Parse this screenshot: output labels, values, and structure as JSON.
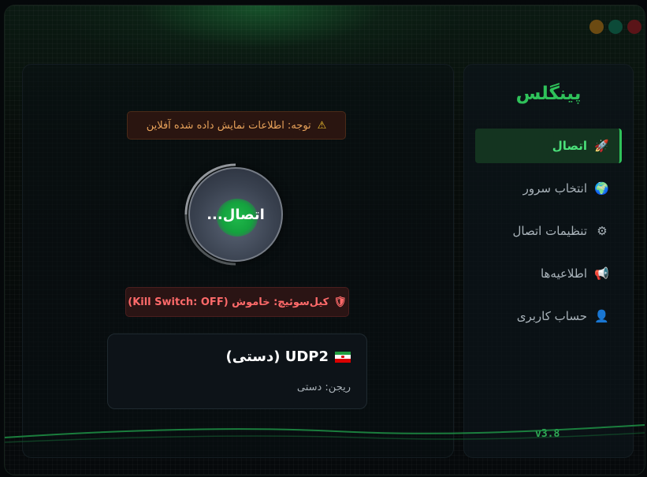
{
  "app": {
    "title": "پینگلس",
    "version": "v3.8"
  },
  "window_controls": [
    "minimize",
    "maximize",
    "close"
  ],
  "sidebar": {
    "items": [
      {
        "label": "اتصال",
        "icon": "rocket-icon",
        "glyph": "🚀",
        "active": true
      },
      {
        "label": "انتخاب سرور",
        "icon": "globe-icon",
        "glyph": "🌍",
        "active": false
      },
      {
        "label": "تنظیمات اتصال",
        "icon": "gear-icon",
        "glyph": "⚙",
        "active": false
      },
      {
        "label": "اطلاعیه‌ها",
        "icon": "megaphone-icon",
        "glyph": "📢",
        "active": false
      },
      {
        "label": "حساب کاربری",
        "icon": "user-icon",
        "glyph": "👤",
        "active": false
      }
    ]
  },
  "main": {
    "notice": "توجه: اطلاعات نمایش داده شده آفلاین",
    "notice_icon": "⚠",
    "connect_button": "اتصال...",
    "kill_switch": "کیل‌سوئیچ: خاموش (Kill Switch: OFF)",
    "kill_switch_icon": "🛡",
    "server": {
      "name": "UDP2 (دستی)",
      "region": "ریجن: دستی",
      "flag": "iran-flag"
    }
  },
  "colors": {
    "accent": "#2fc25a",
    "warning": "#e8a25a",
    "danger": "#ff6a6a"
  }
}
